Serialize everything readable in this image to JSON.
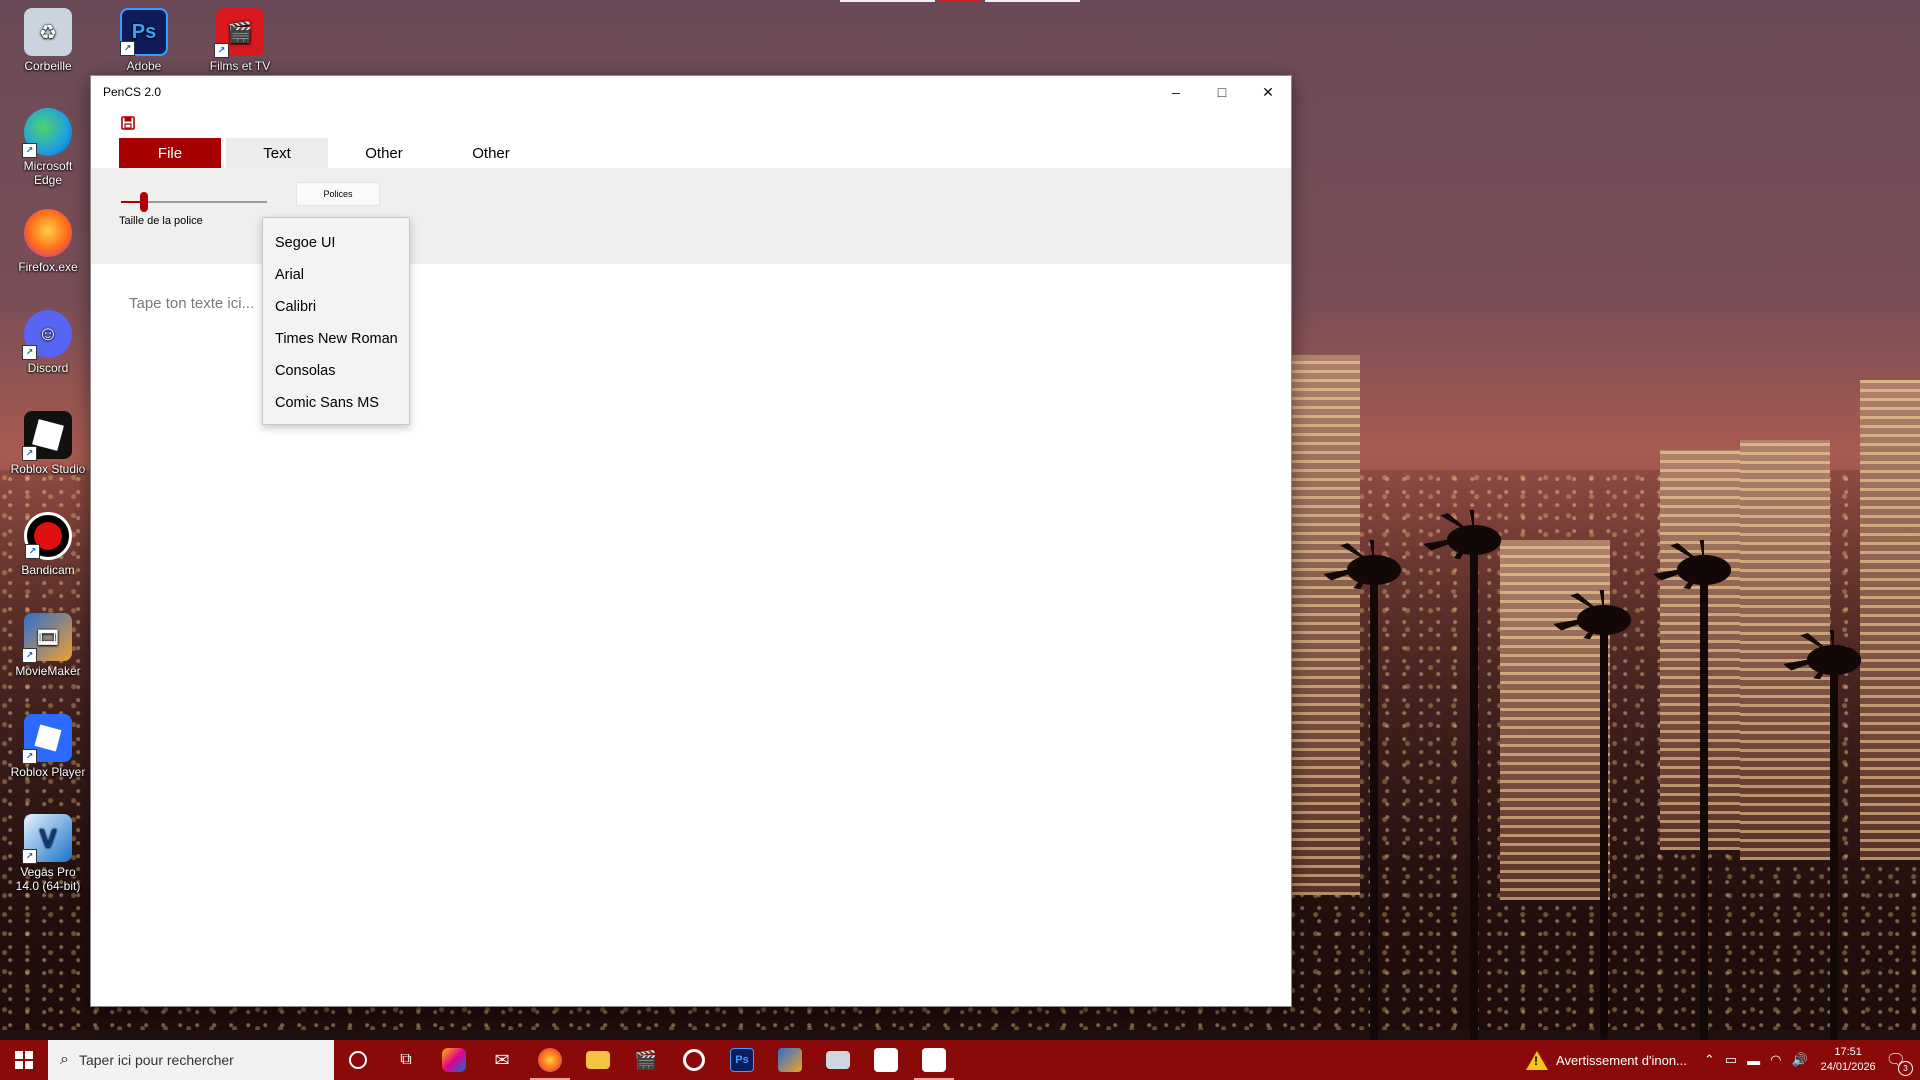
{
  "desktop": {
    "icons": [
      {
        "label": "Corbeille",
        "icon": "recycle-bin-icon",
        "color": "#c9d4e0"
      },
      {
        "label": "Adobe",
        "icon": "photoshop-icon",
        "color": "#0d1d5c",
        "glyph": "Ps"
      },
      {
        "label": "Films et TV",
        "icon": "films-tv-icon",
        "color": "#d8181e"
      },
      {
        "label": "Microsoft Edge",
        "icon": "edge-icon",
        "color": "#1fa0e0"
      },
      {
        "label": "Firefox.exe",
        "icon": "firefox-icon",
        "color": "#ff6a1a"
      },
      {
        "label": "Discord",
        "icon": "discord-icon",
        "color": "#5865f2"
      },
      {
        "label": "Roblox Studio",
        "icon": "roblox-studio-icon",
        "color": "#111111"
      },
      {
        "label": "Bandicam",
        "icon": "bandicam-icon",
        "color": "#000000"
      },
      {
        "label": "MovieMaker",
        "icon": "moviemaker-icon",
        "color": "#2b6fcf"
      },
      {
        "label": "Roblox Player",
        "icon": "roblox-player-icon",
        "color": "#2d6bff"
      },
      {
        "label": "Vegas Pro 14.0 (64-bit)",
        "icon": "vegas-pro-icon",
        "color": "#1a73c9"
      }
    ]
  },
  "window": {
    "title": "PenCS 2.0",
    "controls": {
      "minimize": "–",
      "maximize": "□",
      "close": "✕"
    },
    "tabs": [
      {
        "label": "File",
        "state": "active"
      },
      {
        "label": "Text",
        "state": "selected"
      },
      {
        "label": "Other",
        "state": "normal"
      },
      {
        "label": "Other",
        "state": "normal"
      }
    ],
    "ribbon": {
      "font_size_label": "Taille de la police",
      "font_size_slider_value": 0.14,
      "fonts_button_label": "Polices"
    },
    "font_dropdown": {
      "options": [
        "Segoe UI",
        "Arial",
        "Calibri",
        "Times New Roman",
        "Consolas",
        "Comic Sans MS"
      ]
    },
    "editor": {
      "placeholder": "Tape ton texte ici..."
    },
    "accent_color": "#a60000"
  },
  "taskbar": {
    "search_placeholder": "Taper ici pour rechercher",
    "warning_text": "Avertissement d'inon...",
    "time": "17:51",
    "date": "24/01/2026",
    "notification_count": "3",
    "color": "#8a0a0a"
  }
}
